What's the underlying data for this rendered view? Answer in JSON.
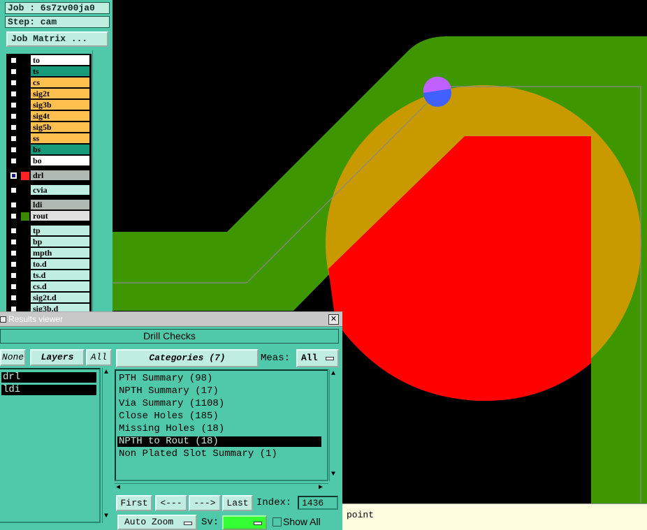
{
  "app": {
    "job_label": "Job : 6s7zv00ja0",
    "step_label": "Step: cam",
    "job_matrix_button": "Job Matrix ..."
  },
  "layers": [
    {
      "name": "to",
      "color": "#ffffff"
    },
    {
      "name": "ts",
      "color": "#169a7a"
    },
    {
      "name": "cs",
      "color": "#ffc050"
    },
    {
      "name": "sig2t",
      "color": "#ffc050"
    },
    {
      "name": "sig3b",
      "color": "#ffc050"
    },
    {
      "name": "sig4t",
      "color": "#ffc050"
    },
    {
      "name": "sig5b",
      "color": "#ffc050"
    },
    {
      "name": "ss",
      "color": "#ffc050"
    },
    {
      "name": "bs",
      "color": "#169a7a"
    },
    {
      "name": "bo",
      "color": "#ffffff"
    },
    {
      "name": "drl",
      "color": "#b0b8b4",
      "swatch": "#ff2020",
      "active": true
    },
    {
      "name": "cvia",
      "color": "#bfeee0"
    },
    {
      "name": "ldi",
      "color": "#b0b8b4"
    },
    {
      "name": "rout",
      "color": "#e0e0e0",
      "swatch": "#3a8a00"
    },
    {
      "name": "tp",
      "color": "#bfeee0"
    },
    {
      "name": "bp",
      "color": "#bfeee0"
    },
    {
      "name": "mpth",
      "color": "#bfeee0"
    },
    {
      "name": "to.d",
      "color": "#bfeee0"
    },
    {
      "name": "ts.d",
      "color": "#bfeee0"
    },
    {
      "name": "cs.d",
      "color": "#bfeee0"
    },
    {
      "name": "sig2t.d",
      "color": "#bfeee0"
    },
    {
      "name": "sig3b.d",
      "color": "#bfeee0"
    }
  ],
  "results_viewer": {
    "title": "Results viewer",
    "close_glyph": "✕",
    "header": "Drill Checks",
    "none_button": "None",
    "layers_button": "Layers",
    "all_button": "All",
    "layer_items": [
      "drl",
      "ldi"
    ],
    "categories_button": "Categories (7)",
    "meas_label": "Meas:",
    "meas_value": "All",
    "categories": [
      {
        "label": "PTH Summary (98)",
        "selected": false
      },
      {
        "label": "NPTH Summary (17)",
        "selected": false
      },
      {
        "label": "Via Summary (1108)",
        "selected": false
      },
      {
        "label": "Close Holes (185)",
        "selected": false
      },
      {
        "label": "Missing Holes (18)",
        "selected": false
      },
      {
        "label": "NPTH to Rout (18)",
        "selected": true
      },
      {
        "label": "Non Plated Slot Summary (1)",
        "selected": false
      }
    ],
    "first_button": "First",
    "prev_button": "<---",
    "next_button": "--->",
    "last_button": "Last",
    "index_label": "Index:",
    "index_value": "1436",
    "auto_zoom_button": "Auto Zoom",
    "sv_label": "Sv:",
    "show_all_label": "Show All"
  },
  "status": {
    "text": "point"
  },
  "colors": {
    "rout_green": "#3e9600",
    "pad_orange": "#c89a00",
    "drill_red": "#ff0000",
    "marker_purple": "#c060ff",
    "marker_blue": "#4060ff",
    "panel_teal": "#4fc9aa"
  }
}
